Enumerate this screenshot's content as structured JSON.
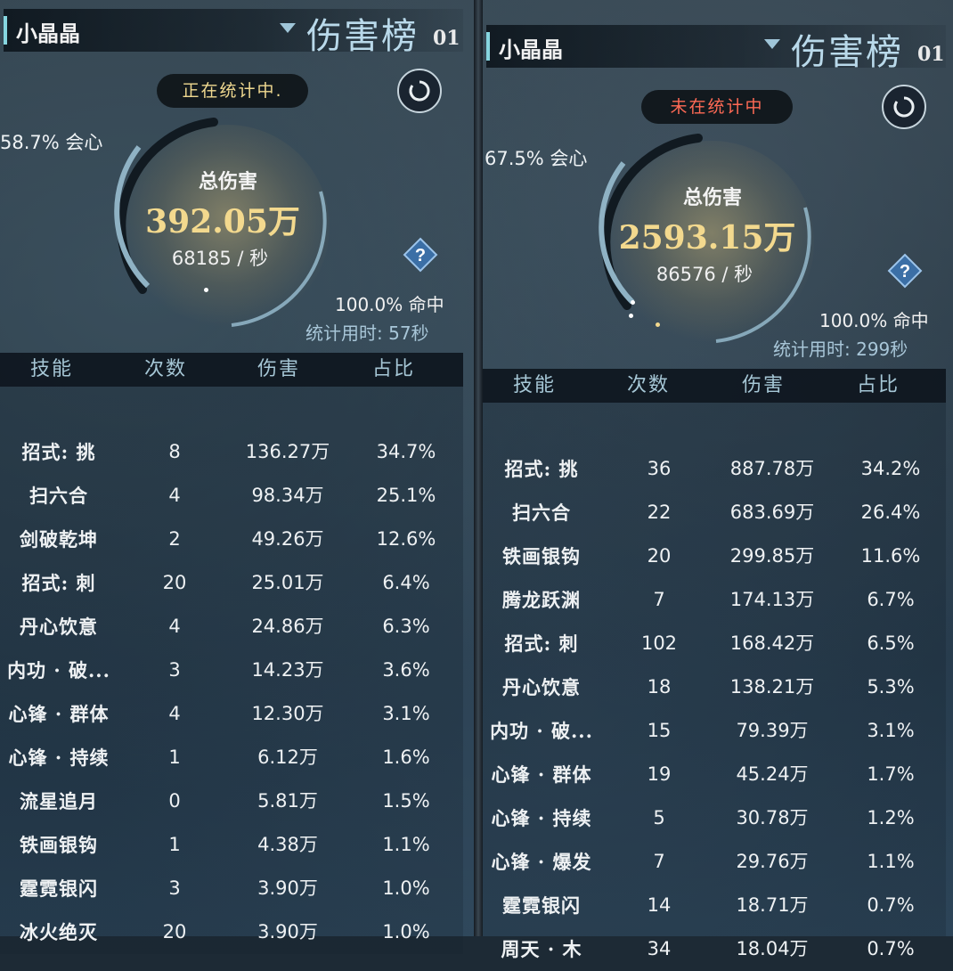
{
  "panels": [
    {
      "player_name": "小晶晶",
      "title": "伤害榜",
      "board_number": "01",
      "status": "正在统计中.",
      "status_color": "#f0d990",
      "crit_rate": "58.7% 会心",
      "total_label": "总伤害",
      "total_damage": "392.05万",
      "dps": "68185 / 秒",
      "hit_rate": "100.0% 命中",
      "duration": "统计用时: 57秒",
      "columns": [
        "技能",
        "次数",
        "伤害",
        "占比"
      ],
      "rows": [
        [
          "招式: 挑",
          "8",
          "136.27万",
          "34.7%"
        ],
        [
          "扫六合",
          "4",
          "98.34万",
          "25.1%"
        ],
        [
          "剑破乾坤",
          "2",
          "49.26万",
          "12.6%"
        ],
        [
          "招式: 刺",
          "20",
          "25.01万",
          "6.4%"
        ],
        [
          "丹心饮意",
          "4",
          "24.86万",
          "6.3%"
        ],
        [
          "内功 · 破...",
          "3",
          "14.23万",
          "3.6%"
        ],
        [
          "心锋 · 群体",
          "4",
          "12.30万",
          "3.1%"
        ],
        [
          "心锋 · 持续",
          "1",
          "6.12万",
          "1.6%"
        ],
        [
          "流星追月",
          "0",
          "5.81万",
          "1.5%"
        ],
        [
          "铁画银钩",
          "1",
          "4.38万",
          "1.1%"
        ],
        [
          "霆霓银闪",
          "3",
          "3.90万",
          "1.0%"
        ],
        [
          "冰火绝灭",
          "20",
          "3.90万",
          "1.0%"
        ]
      ]
    },
    {
      "player_name": "小晶晶",
      "title": "伤害榜",
      "board_number": "01",
      "status": "未在统计中",
      "status_color": "#ff6a55",
      "crit_rate": "67.5% 会心",
      "total_label": "总伤害",
      "total_damage": "2593.15万",
      "dps": "86576 / 秒",
      "hit_rate": "100.0% 命中",
      "duration": "统计用时: 299秒",
      "columns": [
        "技能",
        "次数",
        "伤害",
        "占比"
      ],
      "rows": [
        [
          "招式: 挑",
          "36",
          "887.78万",
          "34.2%"
        ],
        [
          "扫六合",
          "22",
          "683.69万",
          "26.4%"
        ],
        [
          "铁画银钩",
          "20",
          "299.85万",
          "11.6%"
        ],
        [
          "腾龙跃渊",
          "7",
          "174.13万",
          "6.7%"
        ],
        [
          "招式: 刺",
          "102",
          "168.42万",
          "6.5%"
        ],
        [
          "丹心饮意",
          "18",
          "138.21万",
          "5.3%"
        ],
        [
          "内功 · 破...",
          "15",
          "79.39万",
          "3.1%"
        ],
        [
          "心锋 · 群体",
          "19",
          "45.24万",
          "1.7%"
        ],
        [
          "心锋 · 持续",
          "5",
          "30.78万",
          "1.2%"
        ],
        [
          "心锋 · 爆发",
          "7",
          "29.76万",
          "1.1%"
        ],
        [
          "霆霓银闪",
          "14",
          "18.71万",
          "0.7%"
        ],
        [
          "周天 · 木",
          "34",
          "18.04万",
          "0.7%"
        ]
      ]
    }
  ],
  "icons": {
    "dropdown": "chevron-down-icon",
    "refresh": "refresh-icon",
    "help": "help-icon"
  }
}
